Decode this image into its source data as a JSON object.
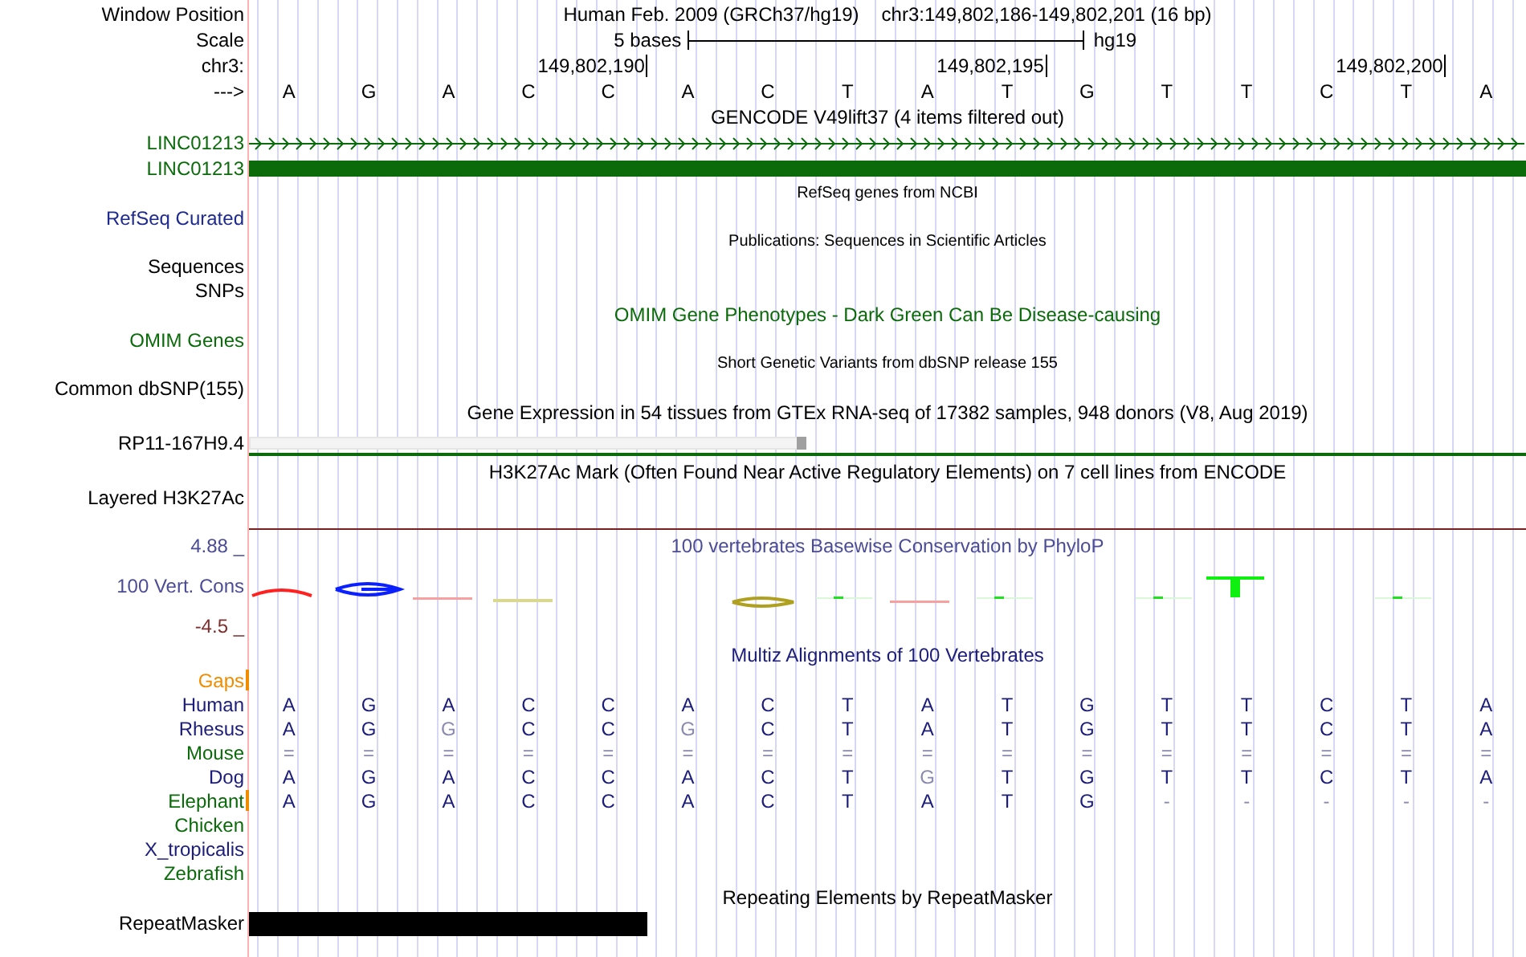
{
  "tracks": [
    {
      "kind": "title",
      "label": "Window Position",
      "title": "Human Feb. 2009 (GRCh37/hg19)",
      "position": "chr3:149,802,186-149,802,201 (16 bp)"
    },
    {
      "kind": "scale",
      "label": "Scale",
      "span": "5 bases",
      "assembly": "hg19"
    },
    {
      "kind": "ruler",
      "label": "chr3:",
      "ticks": [
        "149,802,190",
        "149,802,195",
        "149,802,200"
      ]
    },
    {
      "kind": "bases",
      "label": "--->",
      "bases": [
        "A",
        "G",
        "A",
        "C",
        "C",
        "A",
        "C",
        "T",
        "A",
        "T",
        "G",
        "T",
        "T",
        "C",
        "T",
        "A"
      ]
    },
    {
      "kind": "caption",
      "text": "GENCODE V49lift37 (4 items filtered out)"
    },
    {
      "kind": "gene_strand",
      "label": "LINC01213",
      "color": "#0b6b0b"
    },
    {
      "kind": "gene_block",
      "label": "LINC01213",
      "color": "#0b6b0b"
    },
    {
      "kind": "small_caption",
      "text": "RefSeq genes from NCBI"
    },
    {
      "kind": "label",
      "label": "RefSeq Curated",
      "color": "#1e2a8e"
    },
    {
      "kind": "small_caption",
      "text": "Publications: Sequences in Scientific Articles"
    },
    {
      "kind": "label",
      "label": "Sequences",
      "color": "#000000"
    },
    {
      "kind": "label",
      "label": "SNPs",
      "color": "#000000"
    },
    {
      "kind": "caption",
      "text": "OMIM Gene Phenotypes - Dark Green Can Be Disease-causing",
      "color": "#0b6b0b"
    },
    {
      "kind": "label",
      "label": "OMIM Genes",
      "color": "#0b6b0b"
    },
    {
      "kind": "small_caption",
      "text": "Short Genetic Variants from dbSNP release 155"
    },
    {
      "kind": "label",
      "label": "Common dbSNP(155)",
      "color": "#000000"
    },
    {
      "kind": "caption",
      "text": "Gene Expression in 54 tissues from GTEx RNA-seq of 17382 samples, 948 donors (V8, Aug 2019)"
    },
    {
      "kind": "expression",
      "label": "RP11-167H9.4",
      "color": "#000000"
    },
    {
      "kind": "caption",
      "text": "H3K27Ac Mark (Often Found Near Active Regulatory Elements) on 7 cell lines from ENCODE"
    },
    {
      "kind": "label",
      "label": "Layered H3K27Ac",
      "color": "#000000"
    },
    {
      "kind": "rule",
      "color": "#7a1f1f"
    },
    {
      "kind": "wiggle_top",
      "label": "4.88 _",
      "color": "#4c4c96",
      "text": "100 vertebrates Basewise Conservation by PhyloP"
    },
    {
      "kind": "wiggle",
      "label": "100 Vert. Cons",
      "color": "#4c4c96"
    },
    {
      "kind": "wiggle_bottom",
      "label": "-4.5 _",
      "color": "#7c3030"
    },
    {
      "kind": "caption",
      "text": "Multiz Alignments of 100 Vertebrates",
      "color": "#1c1c7a"
    },
    {
      "kind": "species",
      "label": "Gaps",
      "color": "#f08c00",
      "gap_mark": true
    },
    {
      "kind": "species",
      "label": "Human",
      "color": "#1c1c7a",
      "gap_mark": false,
      "bases": [
        {
          "text": "A",
          "faded": false
        },
        {
          "text": "G",
          "faded": false
        },
        {
          "text": "A",
          "faded": false
        },
        {
          "text": "C",
          "faded": false
        },
        {
          "text": "C",
          "faded": false
        },
        {
          "text": "A",
          "faded": false
        },
        {
          "text": "C",
          "faded": false
        },
        {
          "text": "T",
          "faded": false
        },
        {
          "text": "A",
          "faded": false
        },
        {
          "text": "T",
          "faded": false
        },
        {
          "text": "G",
          "faded": false
        },
        {
          "text": "T",
          "faded": false
        },
        {
          "text": "T",
          "faded": false
        },
        {
          "text": "C",
          "faded": false
        },
        {
          "text": "T",
          "faded": false
        },
        {
          "text": "A",
          "faded": false
        }
      ]
    },
    {
      "kind": "species",
      "label": "Rhesus",
      "color": "#1c1c7a",
      "gap_mark": false,
      "bases": [
        {
          "text": "A",
          "faded": false
        },
        {
          "text": "G",
          "faded": false
        },
        {
          "text": "G",
          "faded": true
        },
        {
          "text": "C",
          "faded": false
        },
        {
          "text": "C",
          "faded": false
        },
        {
          "text": "G",
          "faded": true
        },
        {
          "text": "C",
          "faded": false
        },
        {
          "text": "T",
          "faded": false
        },
        {
          "text": "A",
          "faded": false
        },
        {
          "text": "T",
          "faded": false
        },
        {
          "text": "G",
          "faded": false
        },
        {
          "text": "T",
          "faded": false
        },
        {
          "text": "T",
          "faded": false
        },
        {
          "text": "C",
          "faded": false
        },
        {
          "text": "T",
          "faded": false
        },
        {
          "text": "A",
          "faded": false
        }
      ]
    },
    {
      "kind": "species",
      "label": "Mouse",
      "color": "#0b6b0b",
      "gap_mark": false,
      "bases": [
        {
          "text": "=",
          "faded": true
        },
        {
          "text": "=",
          "faded": true
        },
        {
          "text": "=",
          "faded": true
        },
        {
          "text": "=",
          "faded": true
        },
        {
          "text": "=",
          "faded": true
        },
        {
          "text": "=",
          "faded": true
        },
        {
          "text": "=",
          "faded": true
        },
        {
          "text": "=",
          "faded": true
        },
        {
          "text": "=",
          "faded": true
        },
        {
          "text": "=",
          "faded": true
        },
        {
          "text": "=",
          "faded": true
        },
        {
          "text": "=",
          "faded": true
        },
        {
          "text": "=",
          "faded": true
        },
        {
          "text": "=",
          "faded": true
        },
        {
          "text": "=",
          "faded": true
        },
        {
          "text": "=",
          "faded": true
        }
      ]
    },
    {
      "kind": "species",
      "label": "Dog",
      "color": "#1c1c7a",
      "gap_mark": false,
      "bases": [
        {
          "text": "A",
          "faded": false
        },
        {
          "text": "G",
          "faded": false
        },
        {
          "text": "A",
          "faded": false
        },
        {
          "text": "C",
          "faded": false
        },
        {
          "text": "C",
          "faded": false
        },
        {
          "text": "A",
          "faded": false
        },
        {
          "text": "C",
          "faded": false
        },
        {
          "text": "T",
          "faded": false
        },
        {
          "text": "G",
          "faded": true
        },
        {
          "text": "T",
          "faded": false
        },
        {
          "text": "G",
          "faded": false
        },
        {
          "text": "T",
          "faded": false
        },
        {
          "text": "T",
          "faded": false
        },
        {
          "text": "C",
          "faded": false
        },
        {
          "text": "T",
          "faded": false
        },
        {
          "text": "A",
          "faded": false
        }
      ]
    },
    {
      "kind": "species",
      "label": "Elephant",
      "color": "#0b6b0b",
      "gap_mark": true,
      "bases": [
        {
          "text": "A",
          "faded": false
        },
        {
          "text": "G",
          "faded": false
        },
        {
          "text": "A",
          "faded": false
        },
        {
          "text": "C",
          "faded": false
        },
        {
          "text": "C",
          "faded": false
        },
        {
          "text": "A",
          "faded": false
        },
        {
          "text": "C",
          "faded": false
        },
        {
          "text": "T",
          "faded": false
        },
        {
          "text": "A",
          "faded": false
        },
        {
          "text": "T",
          "faded": false
        },
        {
          "text": "G",
          "faded": false
        },
        {
          "text": "-",
          "faded": true
        },
        {
          "text": "-",
          "faded": true
        },
        {
          "text": "-",
          "faded": true
        },
        {
          "text": "-",
          "faded": true
        },
        {
          "text": "-",
          "faded": true
        }
      ]
    },
    {
      "kind": "species",
      "label": "Chicken",
      "color": "#0b6b0b",
      "gap_mark": false
    },
    {
      "kind": "species",
      "label": "X_tropicalis",
      "color": "#1c1c7a",
      "gap_mark": false
    },
    {
      "kind": "species",
      "label": "Zebrafish",
      "color": "#0b6b0b",
      "gap_mark": false
    },
    {
      "kind": "caption",
      "text": "Repeating Elements by RepeatMasker"
    },
    {
      "kind": "repeat",
      "label": "RepeatMasker",
      "color": "#000000"
    }
  ]
}
